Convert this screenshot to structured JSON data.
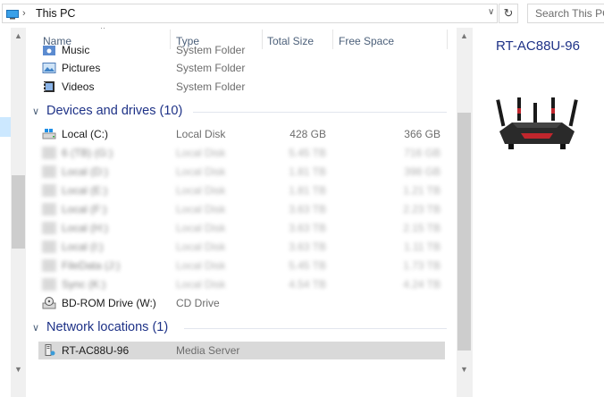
{
  "address": {
    "location": "This PC",
    "search_placeholder": "Search This PC",
    "refresh_glyph": "↻",
    "dropdown_glyph": "∨"
  },
  "columns": {
    "name": "Name",
    "type": "Type",
    "total_size": "Total Size",
    "free_space": "Free Space"
  },
  "folders": [
    {
      "name": "Music",
      "type": "System Folder",
      "icon": "music-folder-icon"
    },
    {
      "name": "Pictures",
      "type": "System Folder",
      "icon": "pictures-folder-icon"
    },
    {
      "name": "Videos",
      "type": "System Folder",
      "icon": "videos-folder-icon"
    }
  ],
  "devices_group": {
    "title": "Devices and drives (10)"
  },
  "drives": [
    {
      "name": "Local (C:)",
      "type": "Local Disk",
      "total": "428 GB",
      "free": "366 GB",
      "blurred": false
    },
    {
      "name": "6 (TB) (G:)",
      "type": "Local Disk",
      "total": "5.45 TB",
      "free": "716 GB",
      "blurred": true
    },
    {
      "name": "Local (D:)",
      "type": "Local Disk",
      "total": "1.81 TB",
      "free": "398 GB",
      "blurred": true
    },
    {
      "name": "Local (E:)",
      "type": "Local Disk",
      "total": "1.81 TB",
      "free": "1.21 TB",
      "blurred": true
    },
    {
      "name": "Local (F:)",
      "type": "Local Disk",
      "total": "3.63 TB",
      "free": "2.23 TB",
      "blurred": true
    },
    {
      "name": "Local (H:)",
      "type": "Local Disk",
      "total": "3.63 TB",
      "free": "2.15 TB",
      "blurred": true
    },
    {
      "name": "Local (I:)",
      "type": "Local Disk",
      "total": "3.63 TB",
      "free": "1.11 TB",
      "blurred": true
    },
    {
      "name": "FileData (J:)",
      "type": "Local Disk",
      "total": "5.45 TB",
      "free": "1.73 TB",
      "blurred": true
    },
    {
      "name": "Sync (K:)",
      "type": "Local Disk",
      "total": "4.54 TB",
      "free": "4.24 TB",
      "blurred": true
    },
    {
      "name": "BD-ROM Drive (W:)",
      "type": "CD Drive",
      "total": "",
      "free": "",
      "blurred": false
    }
  ],
  "network_group": {
    "title": "Network locations (1)"
  },
  "network": [
    {
      "name": "RT-AC88U-96",
      "type": "Media Server"
    }
  ],
  "preview": {
    "title": "RT-AC88U-96"
  },
  "colors": {
    "group_title": "#1e3287",
    "selected_row": "#d9d9d9",
    "header_text": "#4c607a"
  }
}
